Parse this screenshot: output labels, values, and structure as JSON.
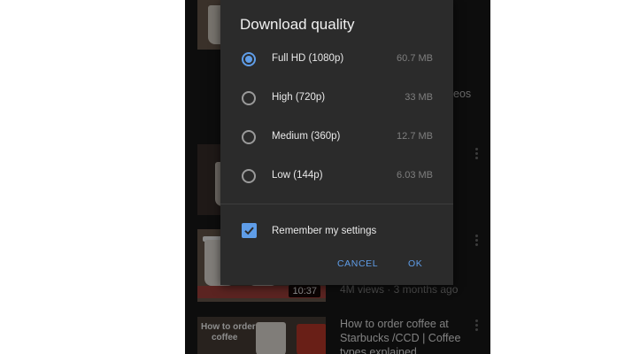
{
  "dialog": {
    "title": "Download quality",
    "options": [
      {
        "label": "Full HD (1080p)",
        "size": "60.7 MB",
        "selected": true
      },
      {
        "label": "High (720p)",
        "size": "33 MB",
        "selected": false
      },
      {
        "label": "Medium (360p)",
        "size": "12.7 MB",
        "selected": false
      },
      {
        "label": "Low (144p)",
        "size": "6.03 MB",
        "selected": false
      }
    ],
    "remember_label": "Remember my settings",
    "remember_checked": true,
    "cancel_label": "CANCEL",
    "ok_label": "OK"
  },
  "background": {
    "peek_text": "eos",
    "video_duration": "10:37",
    "video_meta": "4M views · 3 months ago",
    "next_title": "How to order coffee at Starbucks /CCD | Coffee types explained",
    "thumb_caption_1": "How to order",
    "thumb_caption_2": "coffee"
  },
  "colors": {
    "accent": "#5f9de8",
    "dialog_bg": "#2b2b2b",
    "screen_bg": "#181818"
  }
}
